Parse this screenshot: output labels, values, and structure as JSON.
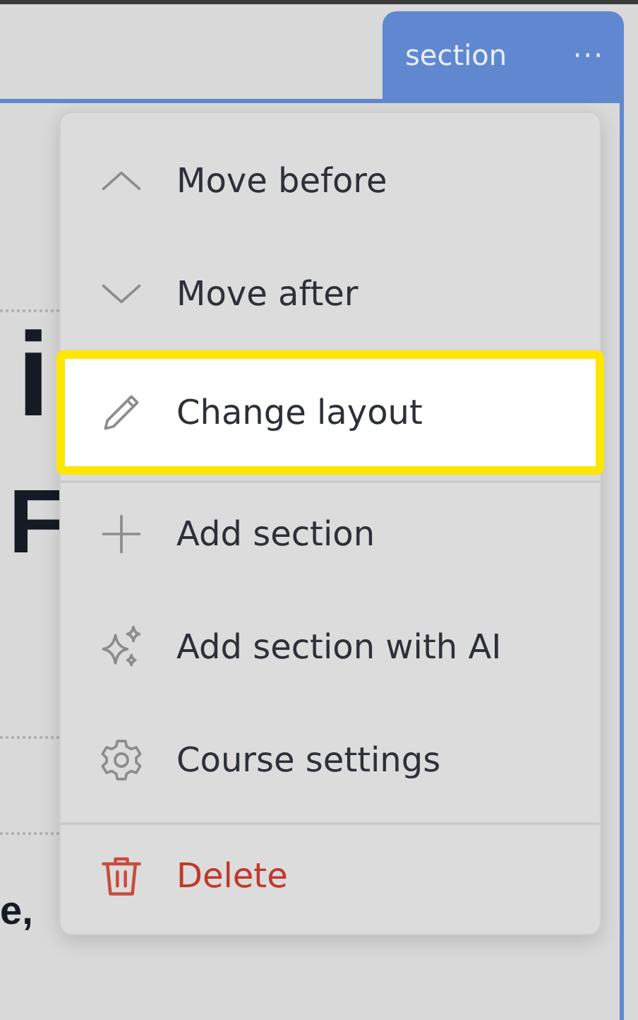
{
  "section_tab": {
    "label": "section",
    "more": "···"
  },
  "background_text": [
    {
      "text": "i",
      "kind": "heading"
    },
    {
      "text": "F",
      "kind": "heading"
    },
    {
      "text": "e,",
      "kind": "subheading"
    }
  ],
  "menu": {
    "groups": [
      {
        "items": [
          {
            "label": "Move before",
            "kind": "up",
            "selected": false
          },
          {
            "label": "Move after",
            "kind": "down",
            "selected": false
          },
          {
            "label": "Change layout",
            "kind": "edit",
            "selected": true
          }
        ]
      },
      {
        "items": [
          {
            "label": "Add section",
            "kind": "add",
            "selected": false
          },
          {
            "label": "Add section with AI",
            "kind": "ai",
            "selected": false
          },
          {
            "label": "Course settings",
            "kind": "settings",
            "selected": false
          }
        ]
      },
      {
        "items": [
          {
            "label": "Delete",
            "kind": "delete",
            "selected": false
          }
        ]
      }
    ]
  }
}
